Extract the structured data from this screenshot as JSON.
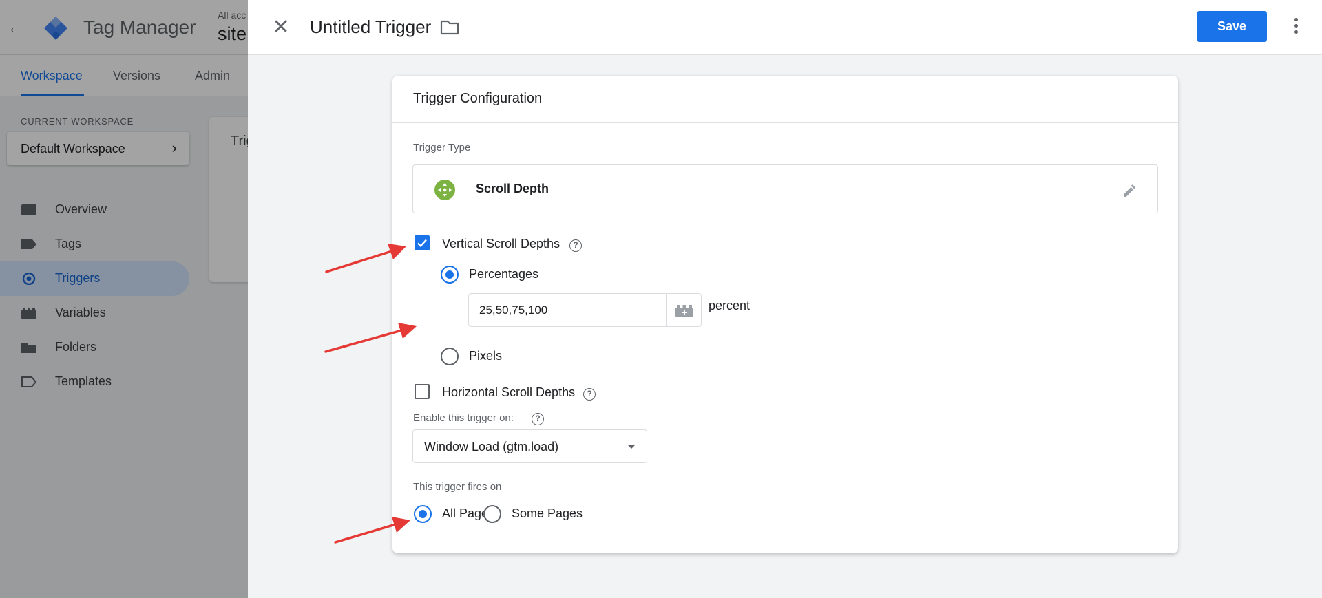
{
  "app": {
    "title": "Tag Manager",
    "account_line": "All acc",
    "site_name": "site",
    "tabs": [
      {
        "label": "Workspace",
        "active": true
      },
      {
        "label": "Versions",
        "active": false
      },
      {
        "label": "Admin",
        "active": false
      }
    ],
    "current_workspace_label": "CURRENT WORKSPACE",
    "workspace_name": "Default Workspace",
    "sidebar": [
      {
        "label": "Overview",
        "icon": "overview-icon",
        "active": false
      },
      {
        "label": "Tags",
        "icon": "tag-icon",
        "active": false
      },
      {
        "label": "Triggers",
        "icon": "trigger-icon",
        "active": true
      },
      {
        "label": "Variables",
        "icon": "variables-icon",
        "active": false
      },
      {
        "label": "Folders",
        "icon": "folder-icon",
        "active": false
      },
      {
        "label": "Templates",
        "icon": "templates-icon",
        "active": false
      }
    ],
    "bg_card_text": "Trig"
  },
  "editor": {
    "trigger_name": "Untitled Trigger",
    "save_label": "Save",
    "card_title": "Trigger Configuration",
    "trigger_type_label": "Trigger Type",
    "trigger_type": "Scroll Depth",
    "vertical": {
      "label": "Vertical Scroll Depths",
      "checked": true
    },
    "percentages": {
      "label": "Percentages",
      "selected": true,
      "value": "25,50,75,100",
      "unit": "percent"
    },
    "pixels": {
      "label": "Pixels",
      "selected": false
    },
    "horizontal": {
      "label": "Horizontal Scroll Depths",
      "checked": false
    },
    "enable_label": "Enable this trigger on:",
    "enable_value": "Window Load (gtm.load)",
    "fires_on_label": "This trigger fires on",
    "fires_on_options": [
      {
        "label": "All Pages",
        "selected": true
      },
      {
        "label": "Some Pages",
        "selected": false
      }
    ]
  },
  "colors": {
    "accent": "#1a73e8",
    "annotation_arrow": "#e53935",
    "scroll_depth_icon": "#7cb342"
  }
}
